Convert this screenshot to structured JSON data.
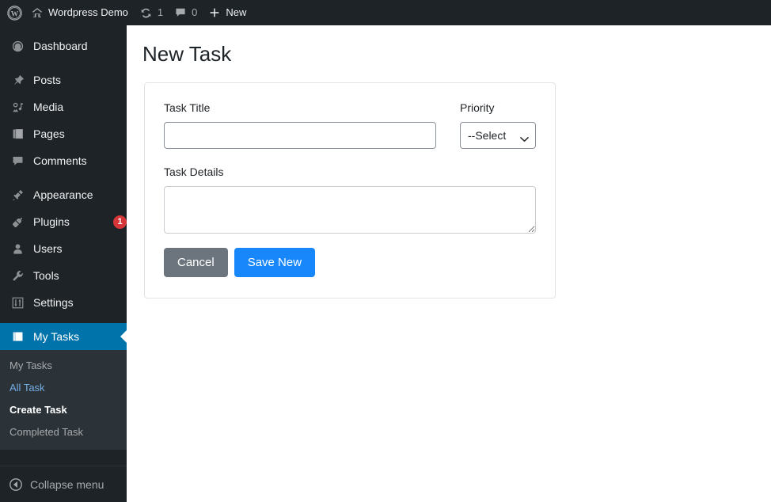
{
  "adminbar": {
    "wp_logo_icon": "wordpress-logo-icon",
    "site_home_icon": "home-icon",
    "site_name": "Wordpress Demo",
    "updates_icon": "update-arrows-icon",
    "updates_count": "1",
    "comments_icon": "comment-bubble-icon",
    "comments_count": "0",
    "new_icon": "plus-icon",
    "new_label": "New"
  },
  "sidebar": {
    "items": [
      {
        "label": "Dashboard",
        "icon": "dashboard-gauge-icon"
      },
      {
        "label": "Posts",
        "icon": "pin-icon"
      },
      {
        "label": "Media",
        "icon": "media-icon"
      },
      {
        "label": "Pages",
        "icon": "pages-icon"
      },
      {
        "label": "Comments",
        "icon": "comment-bubble-icon"
      },
      {
        "label": "Appearance",
        "icon": "paintbrush-icon"
      },
      {
        "label": "Plugins",
        "icon": "plug-icon",
        "badge": "1"
      },
      {
        "label": "Users",
        "icon": "user-icon"
      },
      {
        "label": "Tools",
        "icon": "wrench-icon"
      },
      {
        "label": "Settings",
        "icon": "sliders-icon"
      },
      {
        "label": "My Tasks",
        "icon": "clipboard-icon"
      }
    ],
    "submenu": [
      {
        "label": "My Tasks",
        "state": "header"
      },
      {
        "label": "All Task",
        "state": "link"
      },
      {
        "label": "Create Task",
        "state": "current"
      },
      {
        "label": "Completed Task",
        "state": "link-muted"
      }
    ],
    "collapse": {
      "label": "Collapse menu",
      "icon": "collapse-arrow-left-icon"
    }
  },
  "main": {
    "page_title": "New Task",
    "form": {
      "task_title_label": "Task Title",
      "task_title_value": "",
      "task_title_placeholder": "",
      "priority_label": "Priority",
      "priority_selected": "--Select",
      "priority_options": [
        "--Select"
      ],
      "priority_chevron_icon": "chevron-down-icon",
      "task_details_label": "Task Details",
      "task_details_value": "",
      "task_details_placeholder": "",
      "cancel_label": "Cancel",
      "save_label": "Save New"
    }
  },
  "colors": {
    "admin_bar_bg": "#1d2327",
    "sidebar_bg": "#1d2327",
    "submenu_bg": "#2c3338",
    "active_item_bg": "#0073aa",
    "badge_bg": "#d63638",
    "link_blue": "#72aee6",
    "save_button_bg": "#1787fb",
    "cancel_button_bg": "#6c757d"
  }
}
